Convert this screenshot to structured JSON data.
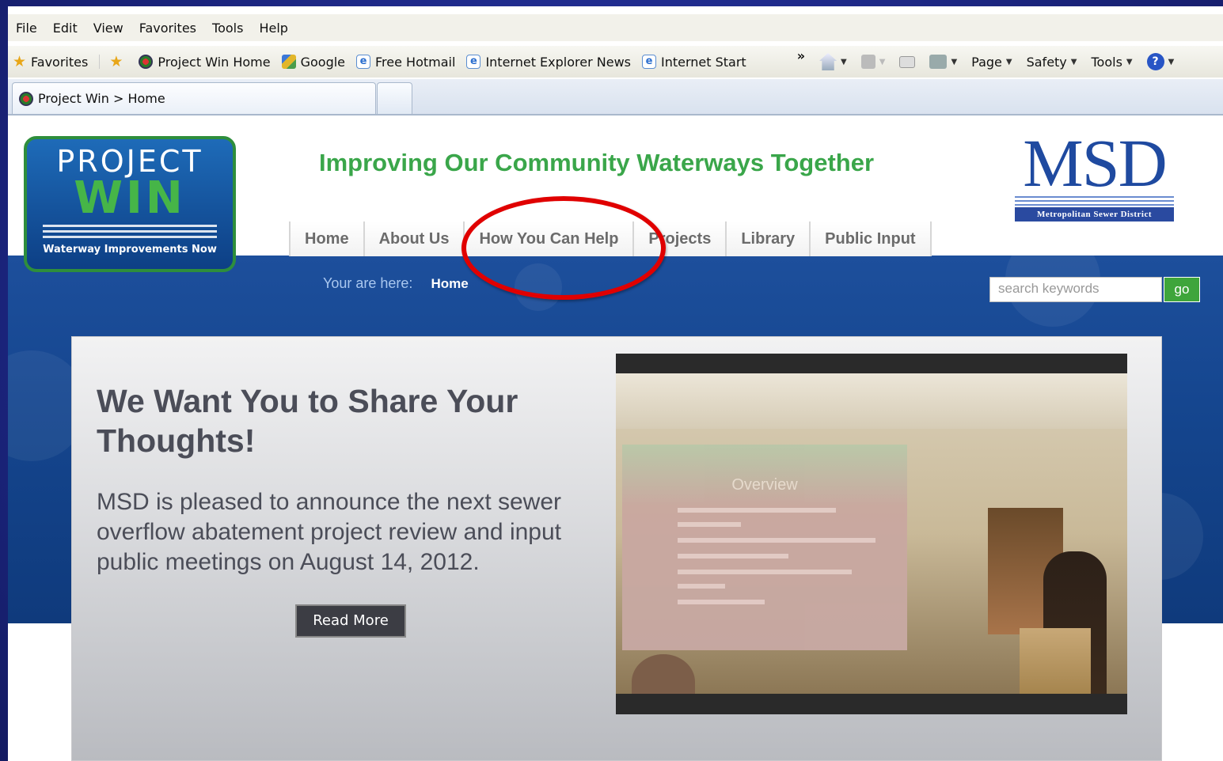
{
  "menu": [
    "File",
    "Edit",
    "View",
    "Favorites",
    "Tools",
    "Help"
  ],
  "favorites_bar": {
    "favorites_label": "Favorites",
    "links": [
      "Project Win Home",
      "Google",
      "Free Hotmail",
      "Internet Explorer News",
      "Internet Start"
    ],
    "more": "»"
  },
  "command_bar": {
    "page": "Page",
    "safety": "Safety",
    "tools": "Tools",
    "help": "?"
  },
  "tab": {
    "title": "Project Win > Home"
  },
  "site": {
    "logo": {
      "line1": "PROJECT",
      "line2": "WIN",
      "tagline": "Waterway Improvements Now"
    },
    "tagline": "Improving Our Community Waterways Together",
    "msd": {
      "letters": "MSD",
      "subtitle": "Metropolitan Sewer District"
    },
    "nav": [
      "Home",
      "About Us",
      "How You Can Help",
      "Projects",
      "Library",
      "Public Input"
    ],
    "breadcrumb": {
      "label": "Your are here:",
      "current": "Home"
    },
    "search": {
      "placeholder": "search keywords",
      "button": "go"
    },
    "hero": {
      "title": "We Want You to Share Your Thoughts!",
      "text": "MSD is pleased to announce the next sewer overflow abatement project review and input public meetings on August 14, 2012.",
      "button": "Read More",
      "screen_title": "Overview"
    }
  },
  "colors": {
    "annotation": "#e00000",
    "accent_green": "#3aa64a",
    "msd_blue": "#1f4aa0"
  }
}
